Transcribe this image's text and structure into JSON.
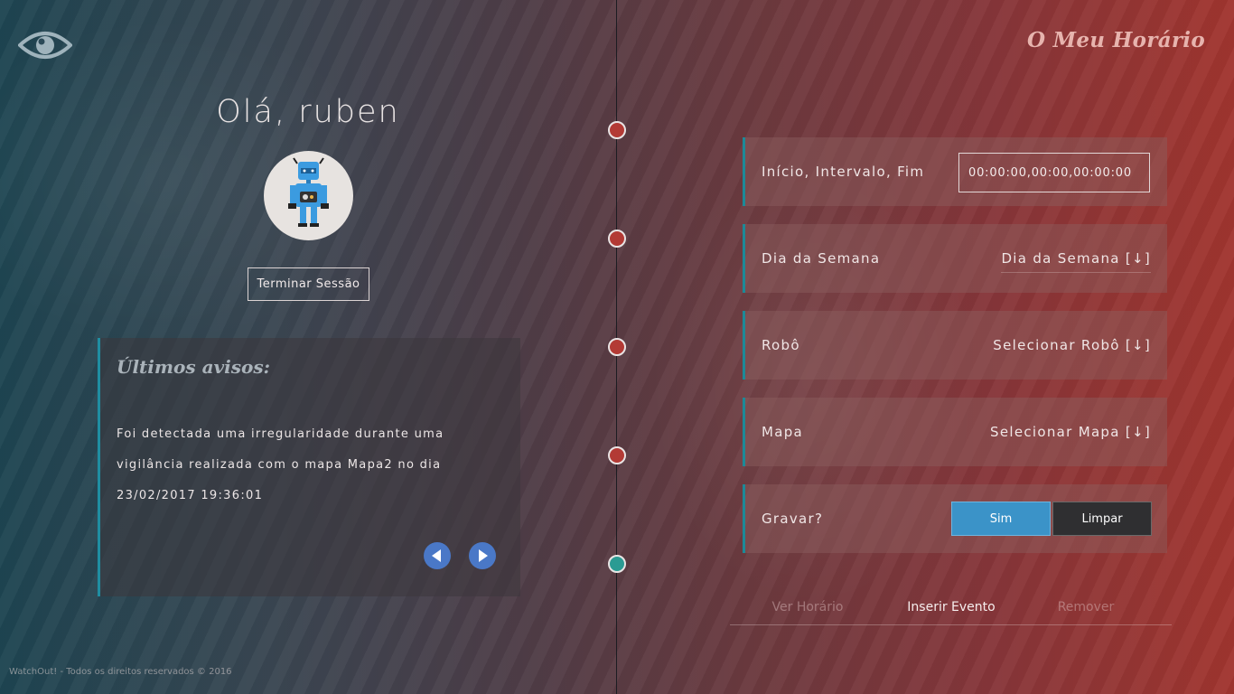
{
  "header": {
    "logo_icon": "eye-icon",
    "brand": "O Meu Horário"
  },
  "profile": {
    "greeting": "Olá, ruben",
    "avatar_icon": "robot-avatar",
    "logout_label": "Terminar Sessão"
  },
  "notices": {
    "title": "Últimos avisos:",
    "message": "Foi detectada uma irregularidade durante uma vigilância realizada com o mapa Mapa2 no dia 23/02/2017 19:36:01",
    "prev_icon": "arrow-left-icon",
    "next_icon": "arrow-right-icon"
  },
  "form": {
    "time_label": "Início, Intervalo, Fim",
    "time_value": "00:00:00,00:00,00:00:00",
    "day_label": "Dia da Semana",
    "day_select": "Dia da Semana [↓]",
    "robot_label": "Robô",
    "robot_select": "Selecionar Robô [↓]",
    "map_label": "Mapa",
    "map_select": "Selecionar Mapa [↓]",
    "save_label": "Gravar?",
    "yes_button": "Sim",
    "clear_button": "Limpar"
  },
  "tabs": [
    "Ver Horário",
    "Inserir Evento",
    "Remover"
  ],
  "active_tab": "Inserir Evento",
  "footer": "WatchOut! - Todos os direitos reservados © 2016",
  "colors": {
    "accent_blue": "#3b93c8",
    "timeline_dot": "#b33a35",
    "timeline_dot_active": "#2b9b93",
    "panel_border": "#1c8a98"
  }
}
